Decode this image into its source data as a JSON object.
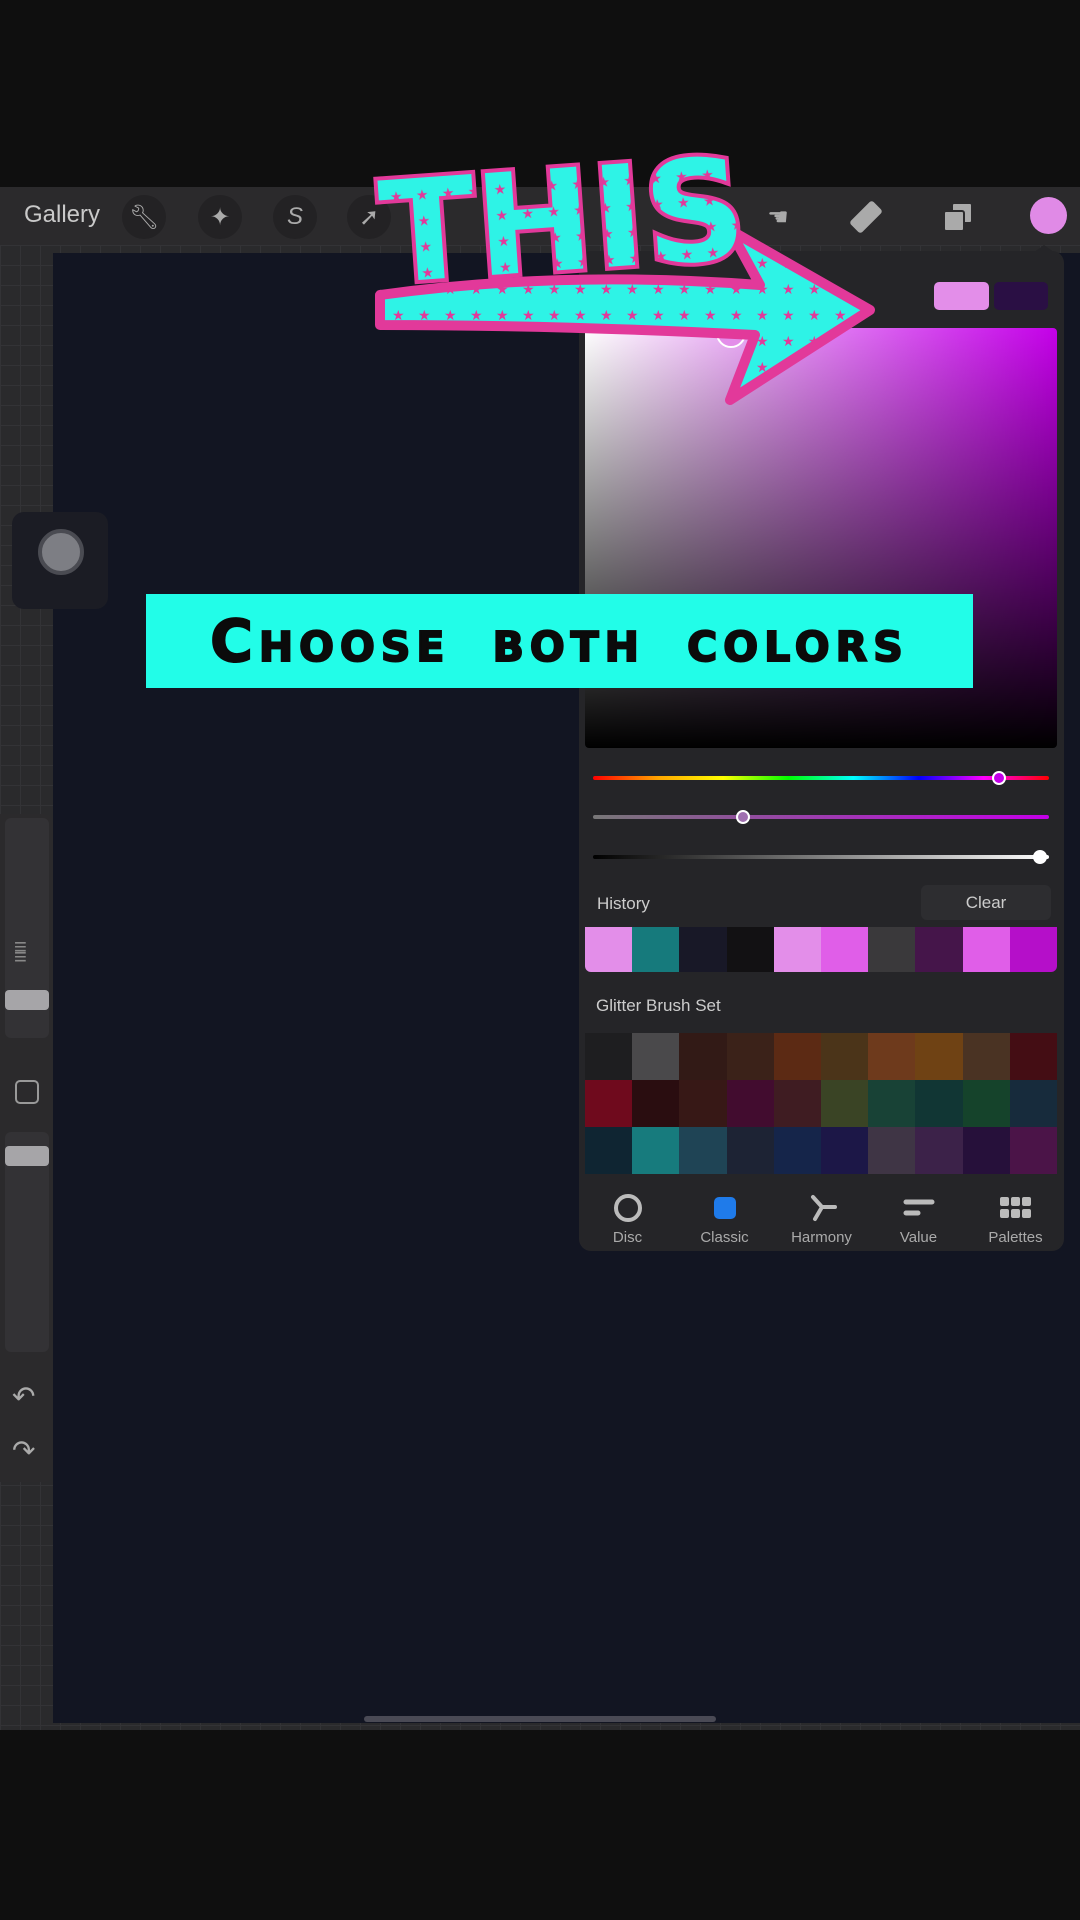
{
  "toolbar": {
    "gallery": "Gallery",
    "icons": [
      "wrench-icon",
      "magic-wand-icon",
      "selection-icon",
      "move-arrow-icon",
      "brush-icon",
      "smudge-icon",
      "eraser-icon",
      "layers-icon",
      "color-icon"
    ],
    "current_color": "#e08ae6"
  },
  "overlay": {
    "sticker_text": "THIS",
    "banner": "Choose both colors"
  },
  "color_panel": {
    "primary": "#e38ee9",
    "secondary": "#2a0f44",
    "hue_position": 0.89,
    "saturation_position": 0.33,
    "brightness_position": 0.98,
    "history_label": "History",
    "clear_label": "Clear",
    "history": [
      "#e38ee9",
      "#167a7c",
      "#181827",
      "#121113",
      "#e38ee9",
      "#e05ee8",
      "#3a393b",
      "#45154a",
      "#e05ee8",
      "#b50fc9"
    ],
    "palette_name": "Glitter Brush Set",
    "palette": [
      [
        "#1e1e20",
        "#4a494b",
        "#321a16",
        "#3b2219",
        "#5c2a14",
        "#4b3419",
        "#6e3a1c",
        "#6f4214",
        "#4a3323",
        "#440d14"
      ],
      [
        "#6f0a1d",
        "#2a0d10",
        "#371816",
        "#420c2f",
        "#3f1c22",
        "#3a4425",
        "#184236",
        "#113634",
        "#15432b",
        "#172b3c"
      ],
      [
        "#0f2532",
        "#177b7d",
        "#1f4455",
        "#1d2334",
        "#15254a",
        "#1c1747",
        "#3f3545",
        "#3c2249",
        "#26103a",
        "#4b1448"
      ]
    ],
    "tabs": [
      {
        "label": "Disc",
        "icon": "disc-icon"
      },
      {
        "label": "Classic",
        "icon": "classic-icon"
      },
      {
        "label": "Harmony",
        "icon": "harmony-icon"
      },
      {
        "label": "Value",
        "icon": "value-icon"
      },
      {
        "label": "Palettes",
        "icon": "palettes-icon"
      }
    ],
    "active_tab": "Classic"
  }
}
